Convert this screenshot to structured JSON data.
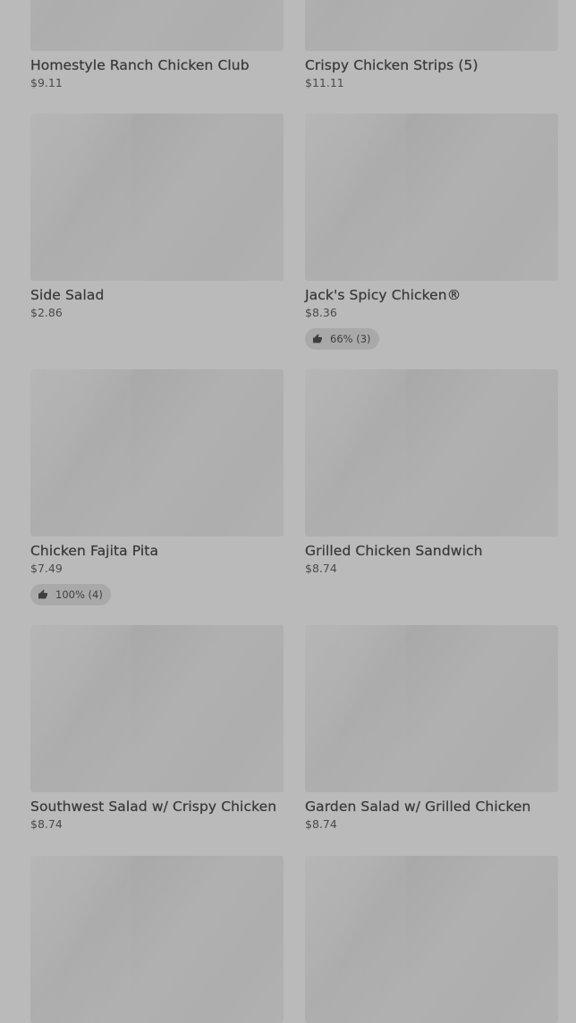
{
  "menu_items": [
    {
      "name": "Homestyle Ranch Chicken Club",
      "price": "$9.11"
    },
    {
      "name": "Crispy Chicken Strips (5)",
      "price": "$11.11"
    },
    {
      "name": "Side Salad",
      "price": "$2.86"
    },
    {
      "name": "Jack's Spicy Chicken®",
      "price": "$8.36",
      "rating": "66% (3)"
    },
    {
      "name": "Chicken Fajita Pita",
      "price": "$7.49",
      "rating": "100% (4)"
    },
    {
      "name": "Grilled Chicken Sandwich",
      "price": "$8.74"
    },
    {
      "name": "Southwest Salad w/ Crispy Chicken",
      "price": "$8.74"
    },
    {
      "name": "Garden Salad w/ Grilled Chicken",
      "price": "$8.74"
    },
    {
      "name": "",
      "price": ""
    },
    {
      "name": "",
      "price": ""
    }
  ],
  "icons": {
    "rating": "thumbs-up-icon"
  }
}
